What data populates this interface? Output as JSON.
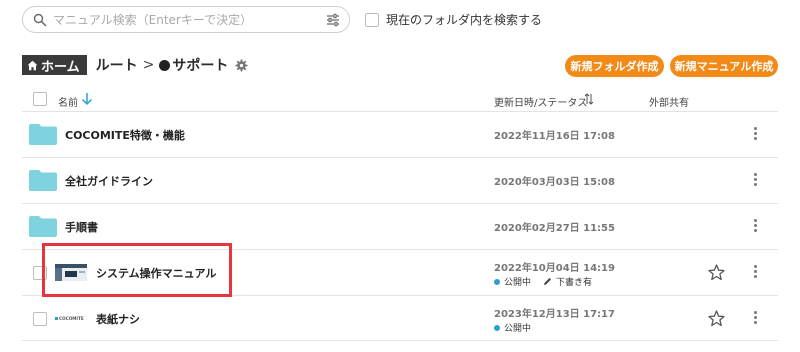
{
  "search": {
    "placeholder": "マニュアル検索（Enterキーで決定）",
    "value": ""
  },
  "folder_search": {
    "label": "現在のフォルダ内を検索する",
    "checked": false
  },
  "breadcrumb": {
    "home": "ホーム",
    "root": "ルート",
    "separator": ">",
    "current": "サポート"
  },
  "buttons": {
    "new_folder": "新規フォルダ作成",
    "new_manual": "新規マニュアル作成"
  },
  "table_header": {
    "name": "名前",
    "updated_status": "更新日時/ステータス",
    "external_share": "外部共有"
  },
  "rows": [
    {
      "type": "folder",
      "name": "COCOMITE特徴・機能",
      "updated": "2022年11月16日 17:08"
    },
    {
      "type": "folder",
      "name": "全社ガイドライン",
      "updated": "2020年03月03日 15:08"
    },
    {
      "type": "folder",
      "name": "手順書",
      "updated": "2020年02月27日 11:55"
    },
    {
      "type": "manual",
      "name": "システム操作マニュアル",
      "updated": "2022年10月04日 14:19",
      "status": "公開中",
      "draft": "下書き有",
      "thumbnail": "screenshot-thumbnail"
    },
    {
      "type": "manual",
      "name": "表紙ナシ",
      "updated": "2023年12月13日 17:17",
      "status": "公開中",
      "thumbnail": "cocomite-logo-thumbnail",
      "thumbnail_text": "COCOMITE"
    }
  ],
  "colors": {
    "accent_orange": "#f28a17",
    "folder_blue": "#7fd3df",
    "status_blue": "#2aa0d0",
    "highlight_red": "#e8353d",
    "home_badge": "#3a3a3a"
  },
  "icons": {
    "search": "search-icon",
    "filter": "filter-sliders-icon",
    "home": "home-icon",
    "settings": "gear-icon",
    "sort_down": "arrow-down-icon",
    "sort_toggle": "sort-arrows-icon",
    "folder": "folder-icon",
    "star": "star-icon",
    "more": "kebab-menu-icon",
    "edit": "pencil-icon"
  }
}
